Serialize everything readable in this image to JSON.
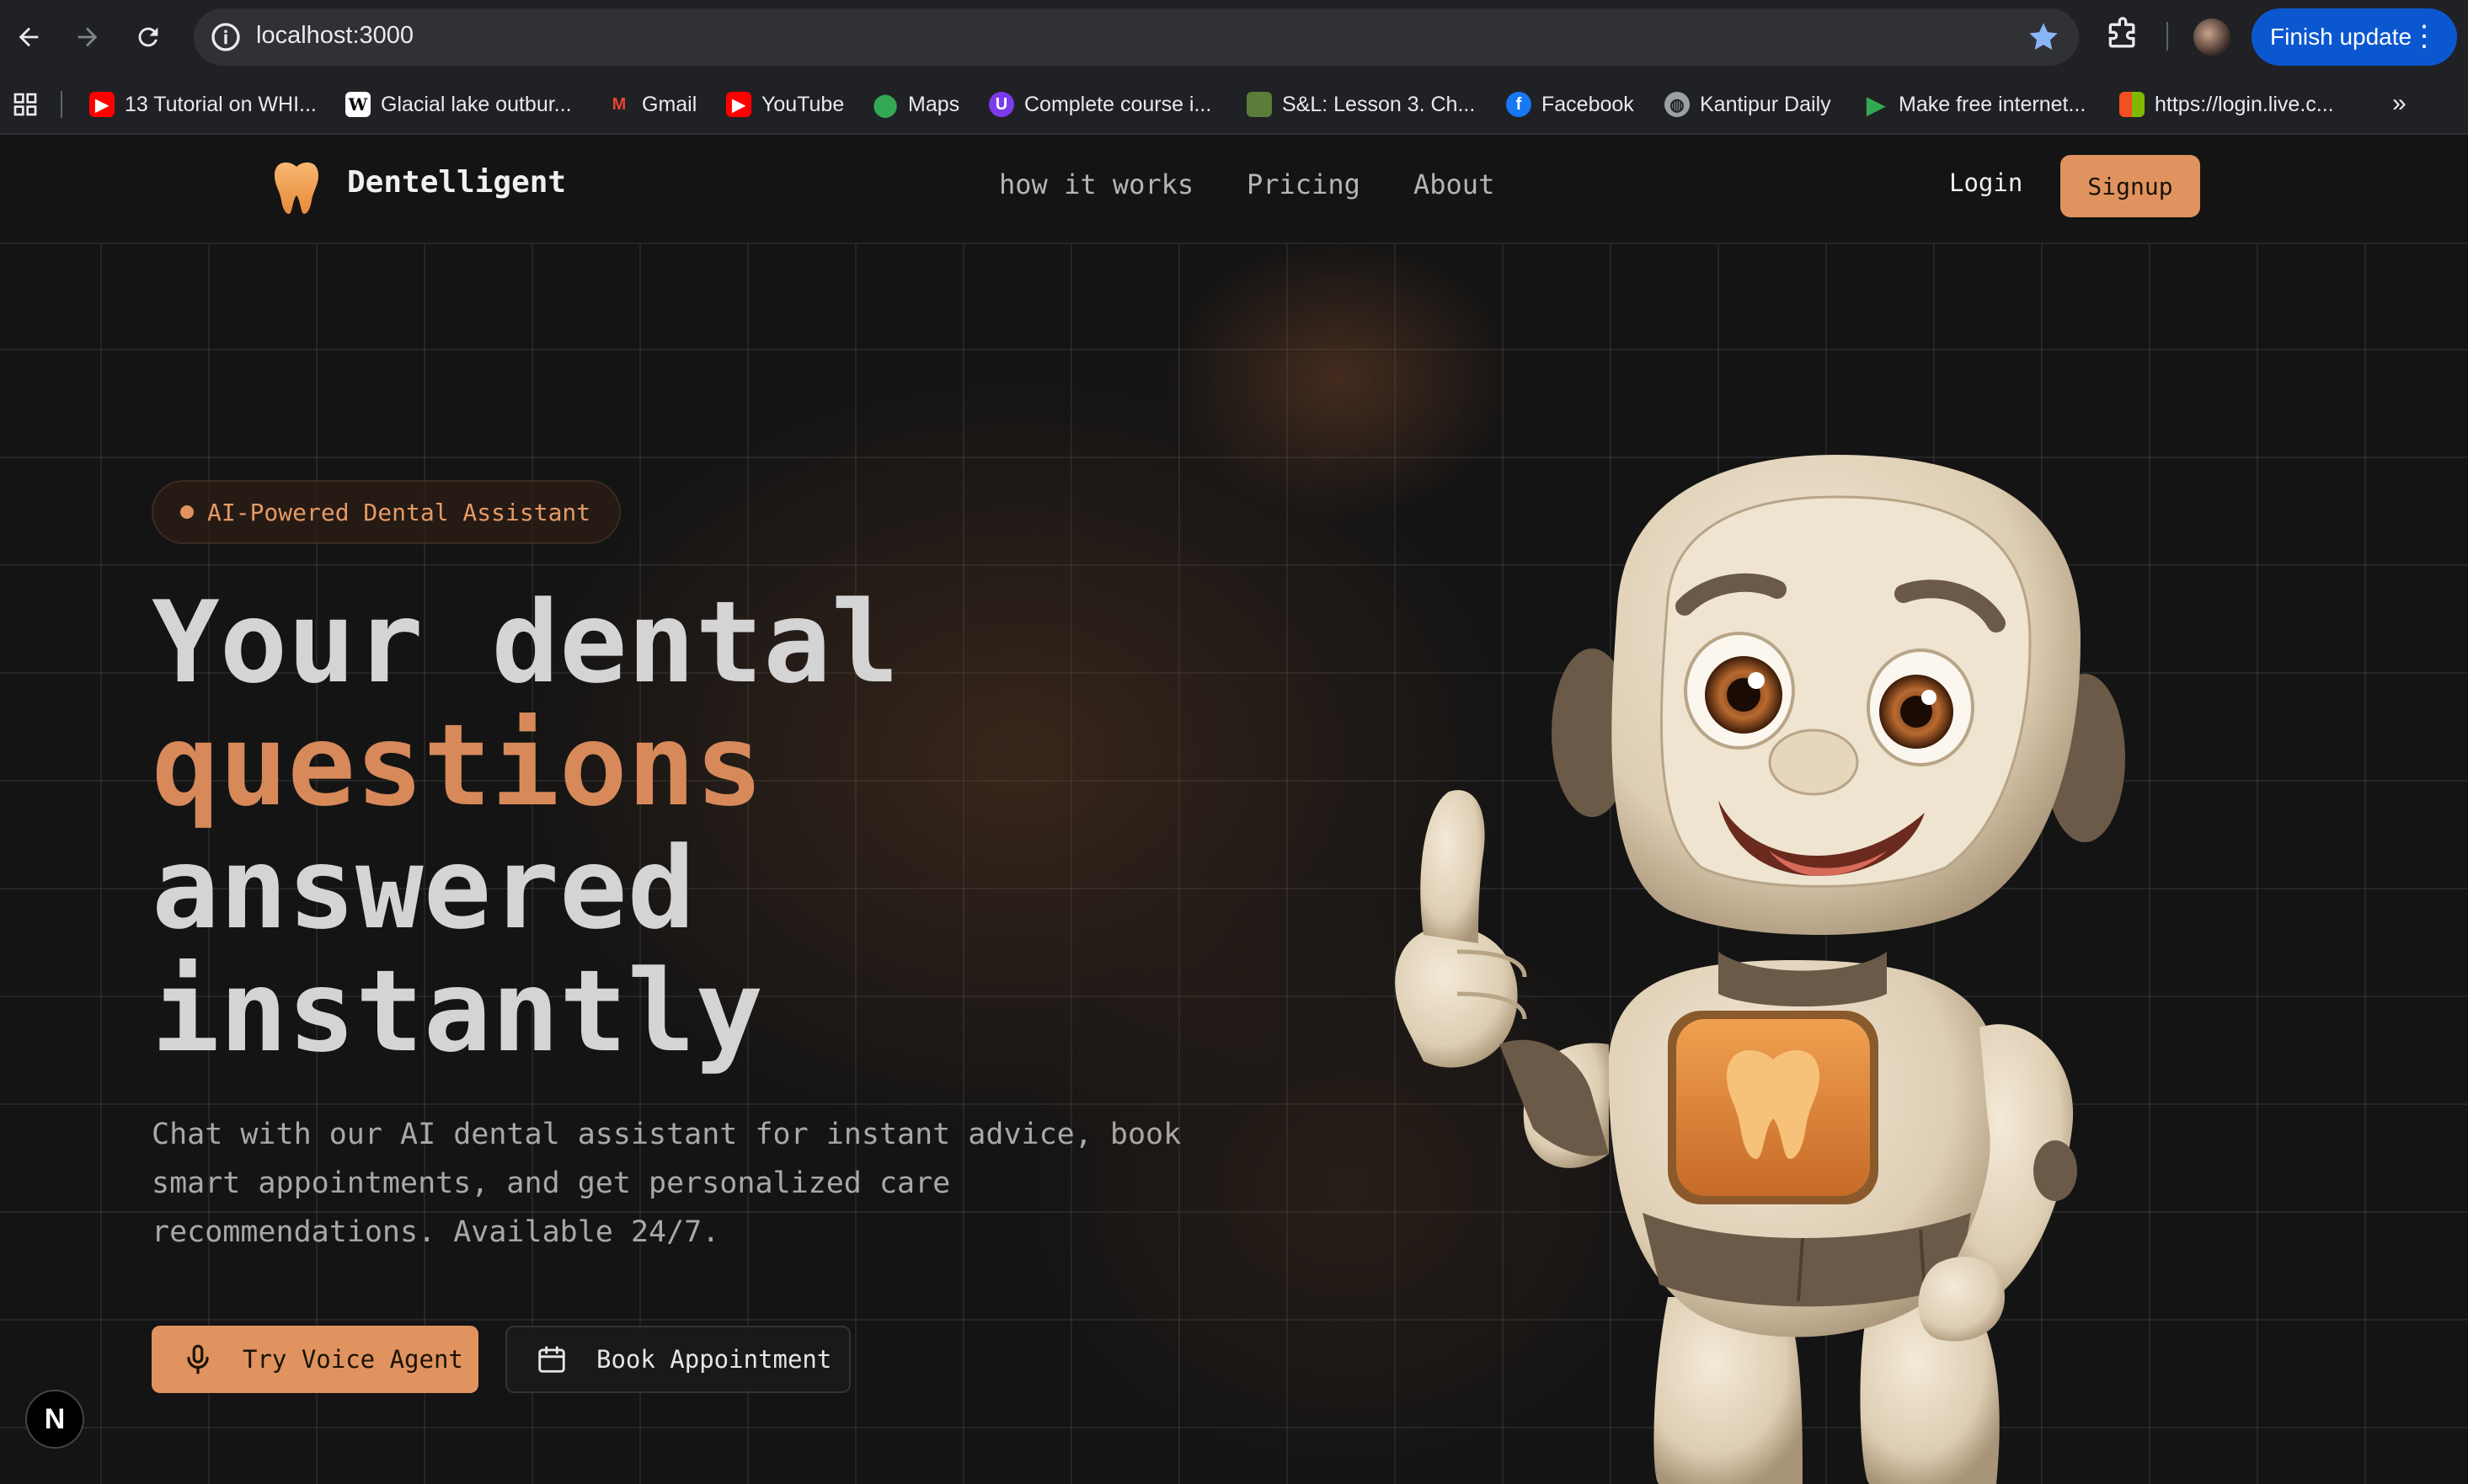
{
  "browser": {
    "url": "localhost:3000",
    "finish_update_label": "Finish update",
    "bookmarks": [
      {
        "label": "13 Tutorial on WHI...",
        "icon": "youtube-icon",
        "color": "#ff0000"
      },
      {
        "label": "Glacial lake outbur...",
        "icon": "wikipedia-icon",
        "color": "#ffffff"
      },
      {
        "label": "Gmail",
        "icon": "gmail-icon",
        "color": "#ea4335"
      },
      {
        "label": "YouTube",
        "icon": "youtube-icon",
        "color": "#ff0000"
      },
      {
        "label": "Maps",
        "icon": "maps-icon",
        "color": "#34a853"
      },
      {
        "label": "Complete course i...",
        "icon": "course-icon",
        "color": "#7c3aed"
      },
      {
        "label": "S&L: Lesson 3. Ch...",
        "icon": "book-icon",
        "color": "#5a7d3a"
      },
      {
        "label": "Facebook",
        "icon": "facebook-icon",
        "color": "#1877f2"
      },
      {
        "label": "Kantipur Daily",
        "icon": "globe-icon",
        "color": "#9aa0a6"
      },
      {
        "label": "Make free internet...",
        "icon": "play-icon",
        "color": "#34a853"
      },
      {
        "label": "https://login.live.c...",
        "icon": "microsoft-icon",
        "color": "#f25022"
      }
    ]
  },
  "site": {
    "brand": "Dentelligent",
    "accent_color": "#e0935e",
    "nav": {
      "how_it_works": "how it works",
      "pricing": "Pricing",
      "about": "About",
      "login": "Login",
      "signup": "Signup"
    },
    "hero": {
      "badge": "AI-Powered Dental Assistant",
      "title_line1": "Your dental",
      "title_line2": "questions",
      "title_line3": "answered",
      "title_line4": "instantly",
      "description": "Chat with our AI dental assistant for instant advice, book smart appointments, and get personalized care recommendations. Available 24/7.",
      "primary_cta": "Try Voice Agent",
      "secondary_cta": "Book Appointment"
    },
    "dev_badge": "N"
  }
}
